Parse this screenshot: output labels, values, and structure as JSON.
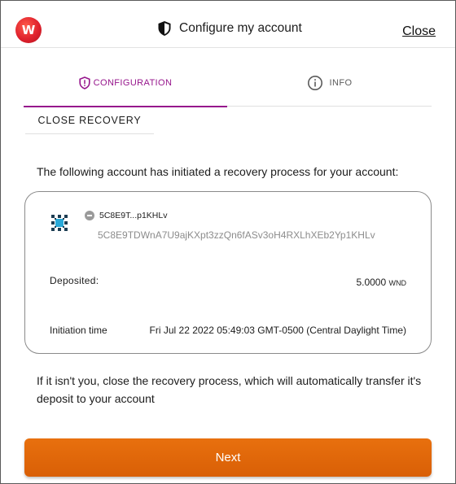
{
  "header": {
    "logo_letter": "W",
    "title": "Configure my account",
    "close_label": "Close"
  },
  "tabs": [
    {
      "label": "CONFIGURATION",
      "icon": "shield-alert-icon",
      "active": true
    },
    {
      "label": "INFO",
      "icon": "info-circle-icon",
      "active": false
    }
  ],
  "subtab": {
    "label": "CLOSE RECOVERY"
  },
  "intro": "The following account has initiated a recovery process for your account:",
  "account": {
    "short_address": "5C8E9T...p1KHLv",
    "full_address": "5C8E9TDWnA7U9ajKXpt3zzQn6fASv3oH4RXLhXEb2Yp1KHLv",
    "deposited_label": "Deposited:",
    "deposited_value": "5.0000",
    "deposited_unit": "WND",
    "initiation_label": "Initiation time",
    "initiation_value": "Fri Jul 22 2022 05:49:03 GMT-0500 (Central Daylight Time)"
  },
  "note": "If it isn't you, close the recovery process, which will automatically transfer it's deposit to your account",
  "next_label": "Next",
  "colors": {
    "accent": "#96158c",
    "button": "#e36a0a",
    "logo": "#e0222d"
  }
}
